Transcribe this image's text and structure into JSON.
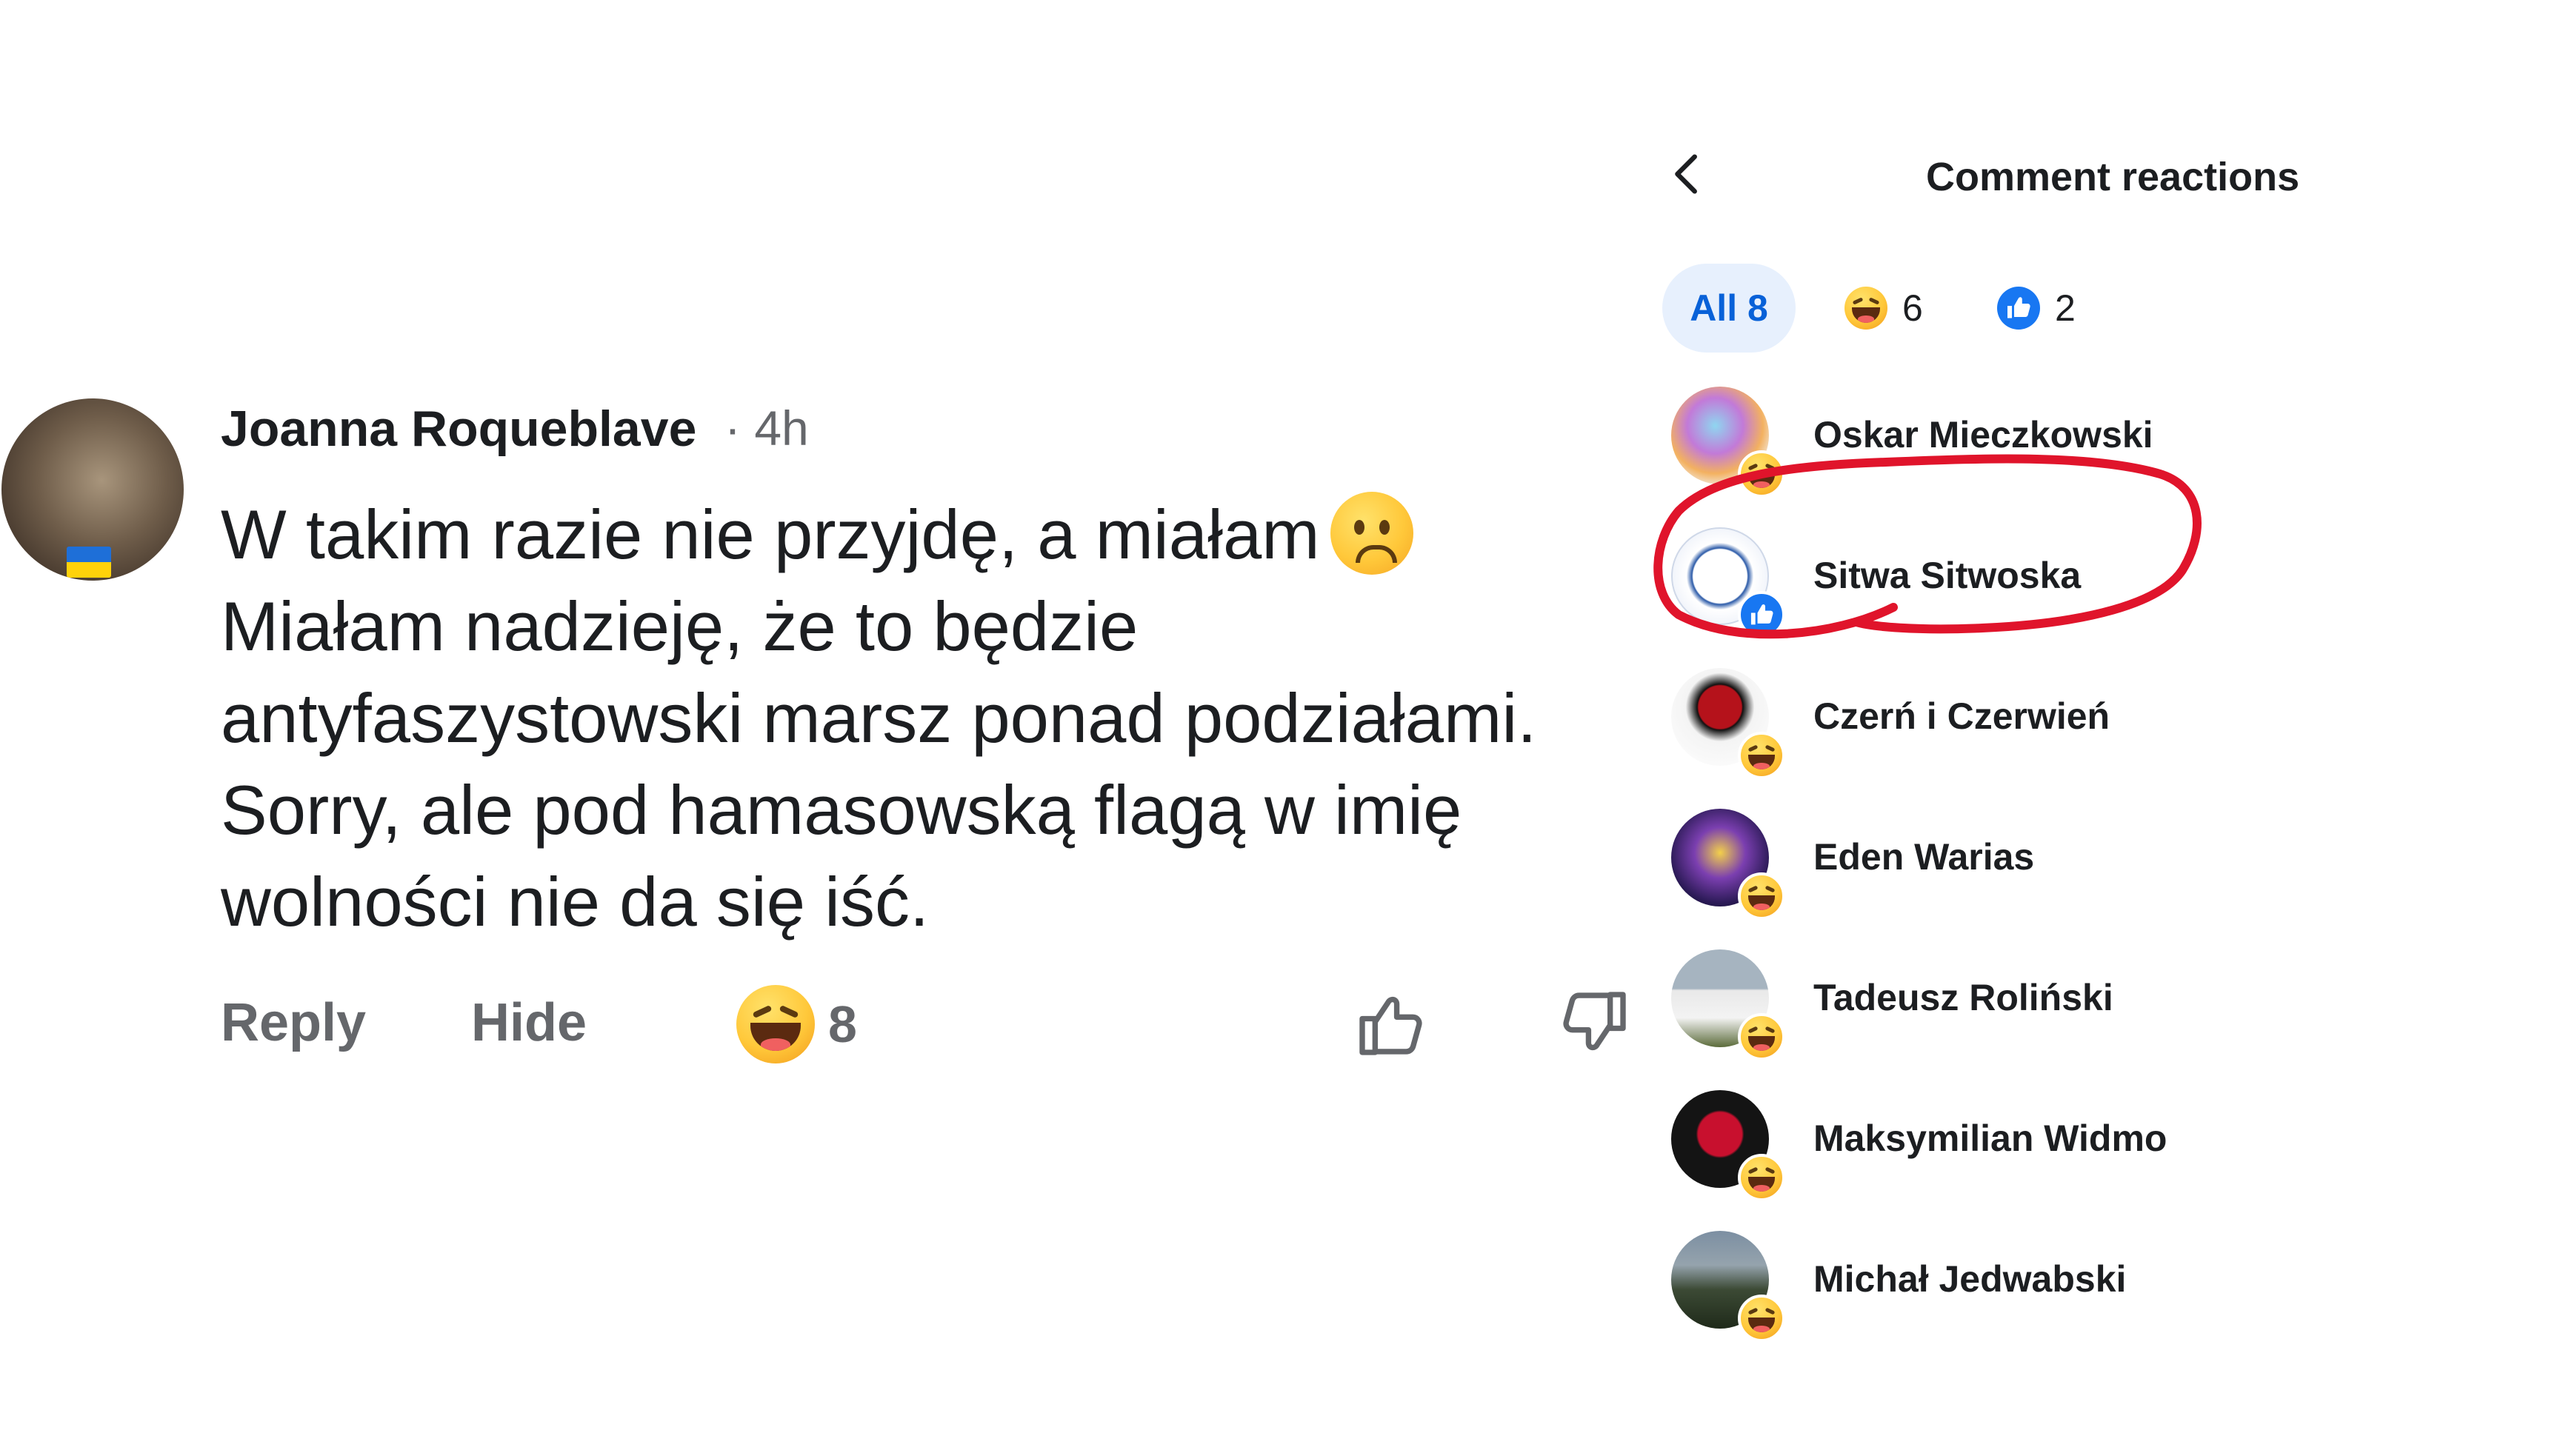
{
  "comment": {
    "author": "Joanna Roqueblave",
    "time": "· 4h",
    "lines": [
      "W takim razie nie przyjdę, a miałam",
      "Miałam nadzieję, że to będzie",
      "antyfaszystowski marsz ponad podziałami.",
      "Sorry, ale pod hamasowską flagą w imię",
      "wolności nie da się iść."
    ],
    "actions": {
      "reply": "Reply",
      "hide": "Hide"
    },
    "reaction_count": "8"
  },
  "panel": {
    "title": "Comment reactions",
    "tabs": {
      "all": "All 8",
      "haha_count": "6",
      "like_count": "2"
    },
    "people": [
      {
        "name": "Oskar Mieczkowski",
        "reaction": "haha"
      },
      {
        "name": "Sitwa Sitwoska",
        "reaction": "like"
      },
      {
        "name": "Czerń i Czerwień",
        "reaction": "haha"
      },
      {
        "name": "Eden Warias",
        "reaction": "haha"
      },
      {
        "name": "Tadeusz Roliński",
        "reaction": "haha"
      },
      {
        "name": "Maksymilian Widmo",
        "reaction": "haha"
      },
      {
        "name": "Michał Jedwabski",
        "reaction": "haha"
      }
    ]
  },
  "colors": {
    "accent": "#0861d8",
    "like_blue": "#1877f2",
    "highlight": "#e0142b",
    "secondary_text": "#65676b"
  }
}
